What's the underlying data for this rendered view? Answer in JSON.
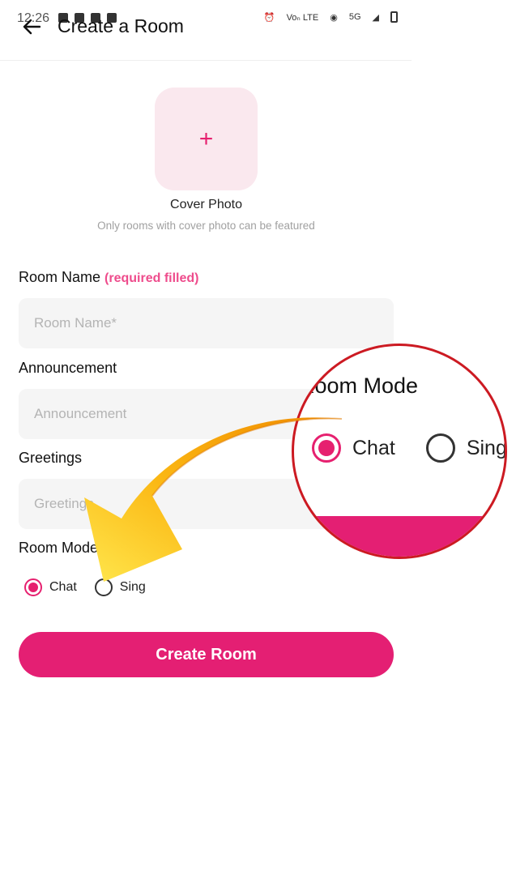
{
  "status_bar": {
    "time": "12:26",
    "network": "5G",
    "lte_label": "Voₙ LTE"
  },
  "header": {
    "title": "Create a Room"
  },
  "cover": {
    "plus": "+",
    "label": "Cover Photo",
    "hint": "Only rooms with cover photo can be featured"
  },
  "form": {
    "room_name": {
      "label": "Room Name",
      "note": "(required filled)",
      "placeholder": "Room Name*"
    },
    "announcement": {
      "label": "Announcement",
      "placeholder": "Announcement"
    },
    "greetings": {
      "label": "Greetings",
      "placeholder": "Greetings"
    },
    "room_mode": {
      "label": "Room Mode",
      "options": [
        {
          "label": "Chat",
          "selected": true
        },
        {
          "label": "Sing",
          "selected": false
        }
      ]
    },
    "submit_label": "Create Room"
  },
  "zoom_callout": {
    "title": "Room Mode",
    "options": [
      "Chat",
      "Sing"
    ]
  },
  "colors": {
    "accent": "#e41f73",
    "accent_light": "#fae8ee",
    "required": "#ee4c8c",
    "input_bg": "#f5f5f5",
    "callout_border": "#cc1a22",
    "arrow": "#f7b500"
  }
}
